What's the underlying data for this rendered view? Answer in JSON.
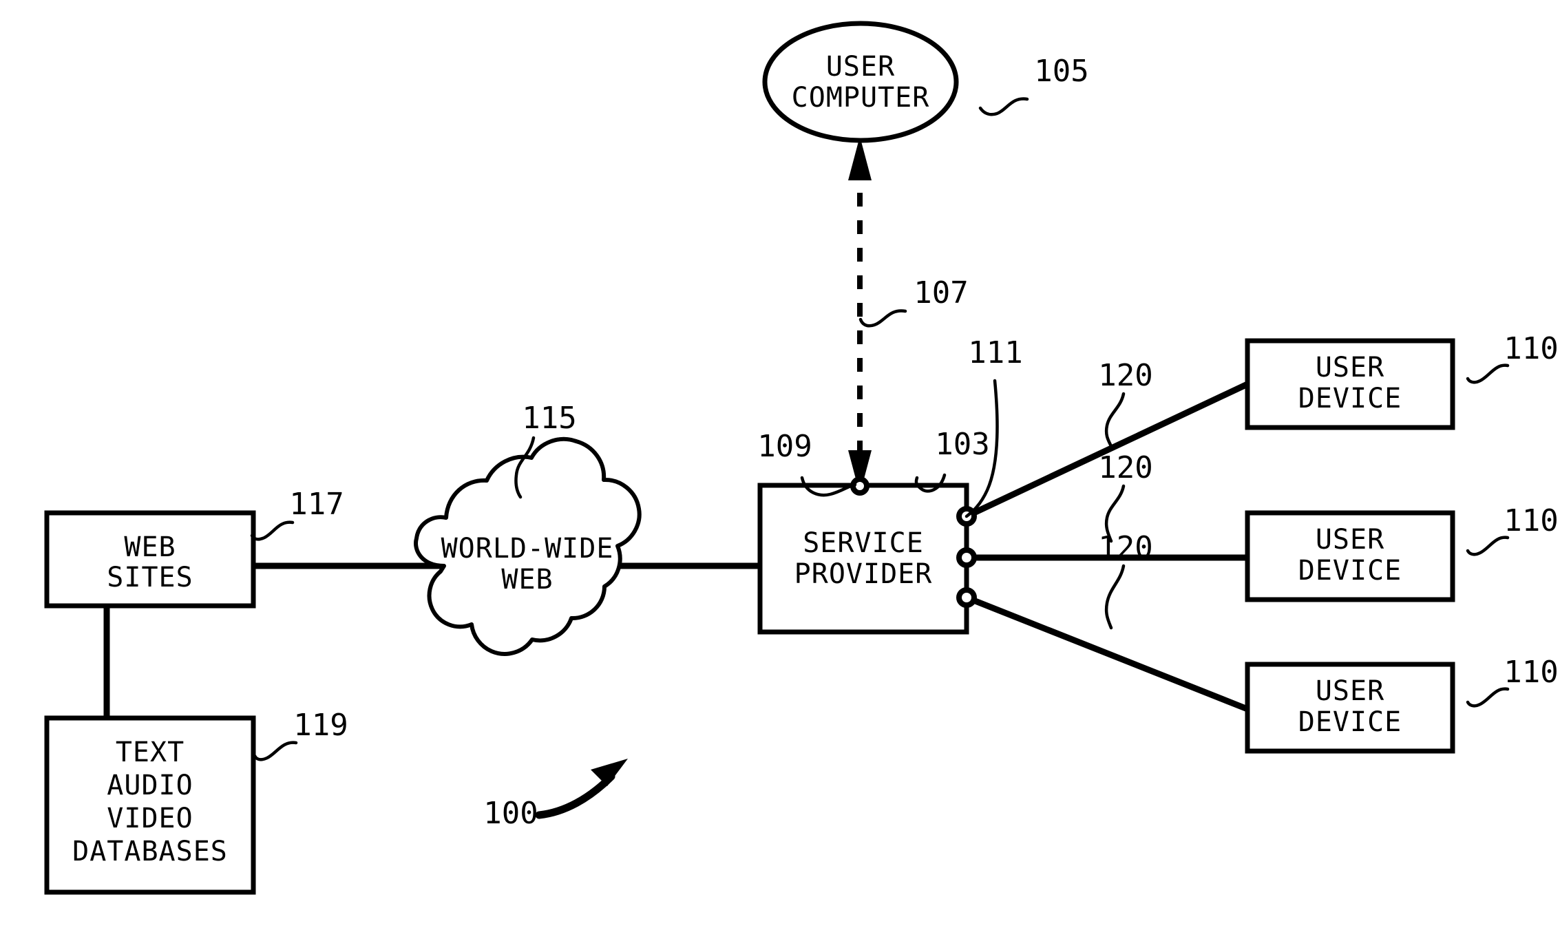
{
  "figure": {
    "reference_numeral": "100",
    "background_color": "#ffffff",
    "line_color": "#000000"
  },
  "nodes": {
    "user_computer": {
      "label_line1": "USER",
      "label_line2": "COMPUTER",
      "reference": "105",
      "shape": "ellipse"
    },
    "service_provider": {
      "label_line1": "SERVICE",
      "label_line2": "PROVIDER",
      "reference": "103",
      "shape": "rectangle",
      "ports_reference": "111"
    },
    "world_wide_web": {
      "label_line1": "WORLD-WIDE",
      "label_line2": "WEB",
      "reference": "115",
      "shape": "cloud"
    },
    "web_sites": {
      "label_line1": "WEB",
      "label_line2": "SITES",
      "reference": "117",
      "shape": "rectangle"
    },
    "databases": {
      "label_line1": "TEXT",
      "label_line2": "AUDIO",
      "label_line3": "VIDEO",
      "label_line4": "DATABASES",
      "reference": "119",
      "shape": "rectangle"
    },
    "user_devices": [
      {
        "label_line1": "USER",
        "label_line2": "DEVICE",
        "reference": "110",
        "link_reference": "120"
      },
      {
        "label_line1": "USER",
        "label_line2": "DEVICE",
        "reference": "110",
        "link_reference": "120"
      },
      {
        "label_line1": "USER",
        "label_line2": "DEVICE",
        "reference": "110",
        "link_reference": "120"
      }
    ]
  },
  "connections": {
    "user_computer_to_service_provider": {
      "reference": "107",
      "style": "dashed",
      "arrowheads": "both",
      "endpoint_reference": "109"
    }
  }
}
